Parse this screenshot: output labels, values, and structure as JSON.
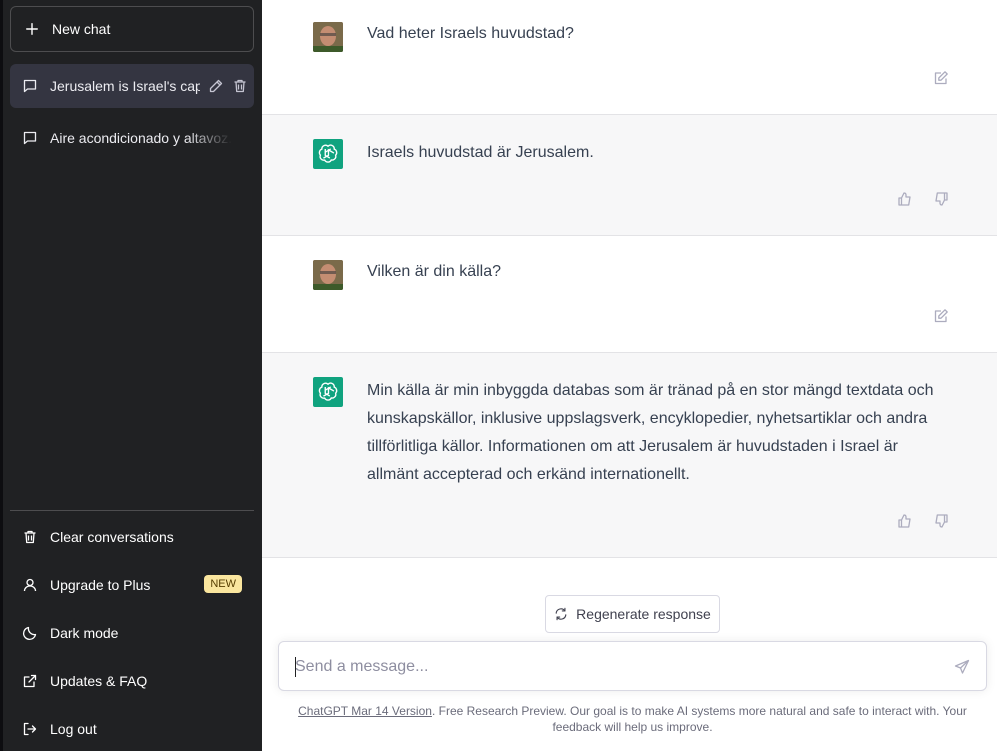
{
  "sidebar": {
    "new_chat_label": "New chat",
    "conversations": [
      {
        "title": "Jerusalem is Israel's cap",
        "active": true
      },
      {
        "title": "Aire acondicionado y altavoz.",
        "active": false
      }
    ],
    "menu": {
      "clear": "Clear conversations",
      "upgrade": "Upgrade to Plus",
      "upgrade_badge": "NEW",
      "dark_mode": "Dark mode",
      "updates": "Updates & FAQ",
      "logout": "Log out"
    }
  },
  "messages": [
    {
      "role": "user",
      "text": "Vad heter Israels huvudstad?"
    },
    {
      "role": "assistant",
      "text": "Israels huvudstad är Jerusalem."
    },
    {
      "role": "user",
      "text": "Vilken är din källa?"
    },
    {
      "role": "assistant",
      "text": "Min källa är min inbyggda databas som är tränad på en stor mängd textdata och kunskapskällor, inklusive uppslagsverk, encyklopedier, nyhetsartiklar och andra tillförlitliga källor. Informationen om att Jerusalem är huvudstaden i Israel är allmänt accepterad och erkänd internationellt."
    }
  ],
  "composer": {
    "regenerate_label": "Regenerate response",
    "placeholder": "Send a message...",
    "value": ""
  },
  "footer": {
    "link": "ChatGPT Mar 14 Version",
    "text": ". Free Research Preview. Our goal is to make AI systems more natural and safe to interact with. Your feedback will help us improve."
  },
  "colors": {
    "sidebar_bg": "#202123",
    "active_conv_bg": "#343541",
    "assistant_avatar": "#10a37f",
    "assistant_row_bg": "#f7f7f8",
    "badge_bg": "#fae69e"
  },
  "icons": {
    "new_chat": "plus-icon",
    "conversation": "chat-bubble-icon",
    "rename": "pencil-icon",
    "delete": "trash-icon",
    "clear": "trash-icon",
    "upgrade": "user-icon",
    "dark_mode": "moon-icon",
    "updates": "external-link-icon",
    "logout": "logout-icon",
    "edit_message": "edit-icon",
    "thumbs_up": "thumbs-up-icon",
    "thumbs_down": "thumbs-down-icon",
    "regenerate": "refresh-icon",
    "send": "send-icon"
  }
}
